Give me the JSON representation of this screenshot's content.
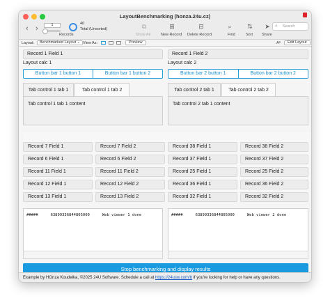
{
  "window": {
    "title": "LayoutBenchmarking (honza.24u.cz)"
  },
  "toolbar": {
    "back_icon": "chevron-left-icon",
    "forward_icon": "chevron-right-icon",
    "record_current": "1",
    "record_count": "40",
    "record_total": "Total (Unsorted)",
    "records_label": "Records",
    "show_all_label": "Show All",
    "new_record_label": "New Record",
    "delete_record_label": "Delete Record",
    "find_label": "Find",
    "sort_label": "Sort",
    "share_label": "Share",
    "search_placeholder": "Search"
  },
  "layoutbar": {
    "layout_label": "Layout:",
    "layout_value": "Benchmarked Layout",
    "view_as_label": "View As:",
    "preview_label": "Preview",
    "font_icon_label": "Aᴬ",
    "edit_layout_label": "Edit Layout"
  },
  "left": {
    "field1": "Record 1 Field 1",
    "calc": "Layout calc 1",
    "buttonbar": [
      "Button bar 1 button 1",
      "Button bar 1 button 2"
    ],
    "tabs": [
      "Tab control 1 tab 1",
      "Tab control 1 tab 2"
    ],
    "tab_content": "Tab control 1 tab 1 content",
    "portal": [
      [
        "Record 7 Field 1",
        "Record 7 Field 2"
      ],
      [
        "Record 6 Field 1",
        "Record 6 Field 2"
      ],
      [
        "Record 11 Field 1",
        "Record 11 Field 2"
      ],
      [
        "Record 12 Field 1",
        "Record 12 Field 2"
      ],
      [
        "Record 13 Field 1",
        "Record 13 Field 2"
      ]
    ],
    "web_hash": "#####",
    "web_number": "63899336844805000",
    "web_status": "Web viewer 1 done"
  },
  "right": {
    "field2": "Record 1 Field 2",
    "calc": "Layout calc 2",
    "buttonbar": [
      "Button bar 2 button 1",
      "Button bar 2 button 2"
    ],
    "tabs": [
      "Tab control 2 tab 1",
      "Tab control 2 tab 2"
    ],
    "tab_content": "Tab control 2 tab 1 content",
    "portal": [
      [
        "Record 38 Field 1",
        "Record 38 Field 2"
      ],
      [
        "Record 37 Field 1",
        "Record 37 Field 2"
      ],
      [
        "Record 25 Field 1",
        "Record 25 Field 2"
      ],
      [
        "Record 36 Field 1",
        "Record 36 Field 2"
      ],
      [
        "Record 32 Field 1",
        "Record 32 Field 2"
      ]
    ],
    "web_hash": "#####",
    "web_number": "63899336844805000",
    "web_status": "Web viewer 2 done"
  },
  "stop_button": "Stop benchmarking and display results",
  "footer": {
    "prefix": "Example by HOnza Koudelka, ©2025 24U Software. Schedule a call at ",
    "link": "https://24usw.com/tt",
    "suffix": " if you're looking for help or have any questions."
  },
  "colors": {
    "accent": "#1a9be0",
    "link": "#1a5ec5"
  }
}
